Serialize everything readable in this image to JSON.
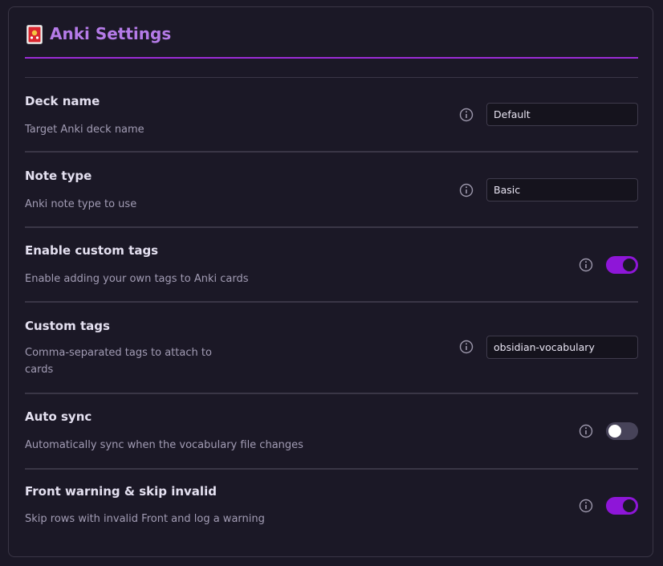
{
  "header": {
    "icon": "flower-playing-cards-icon",
    "title": "Anki Settings",
    "accent_color": "#9b2bd6",
    "title_color": "#b57be8"
  },
  "settings": [
    {
      "title": "Deck name",
      "description": "Target Anki deck name",
      "control": "text",
      "value": "Default",
      "info_icon": "info-icon"
    },
    {
      "title": "Note type",
      "description": "Anki note type to use",
      "control": "text",
      "value": "Basic",
      "info_icon": "info-icon"
    },
    {
      "title": "Enable custom tags",
      "description": "Enable adding your own tags to Anki cards",
      "control": "toggle",
      "enabled": true,
      "info_icon": "info-icon"
    },
    {
      "title": "Custom tags",
      "description": "Comma-separated tags to attach to cards",
      "control": "text",
      "value": "obsidian-vocabulary",
      "info_icon": "info-icon"
    },
    {
      "title": "Auto sync",
      "description": "Automatically sync when the vocabulary file changes",
      "control": "toggle",
      "enabled": false,
      "info_icon": "info-icon"
    },
    {
      "title": "Front warning & skip invalid",
      "description": "Skip rows with invalid Front and log a warning",
      "control": "toggle",
      "enabled": true,
      "info_icon": "info-icon"
    }
  ],
  "colors": {
    "toggle_on": "#8e16d8",
    "toggle_off": "#474359",
    "background": "#1b1826"
  }
}
